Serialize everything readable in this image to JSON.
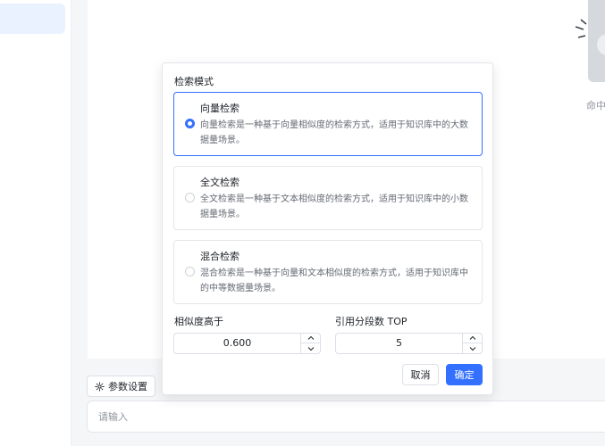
{
  "empty_state": {
    "hint_text": "命中"
  },
  "toolbar": {
    "param_settings_label": "参数设置"
  },
  "chat": {
    "input_placeholder": "请输入"
  },
  "popover": {
    "section_title": "检索模式",
    "options": [
      {
        "title": "向量检索",
        "description": "向量检索是一种基于向量相似度的检索方式，适用于知识库中的大数据量场景。",
        "selected": true
      },
      {
        "title": "全文检索",
        "description": "全文检索是一种基于文本相似度的检索方式，适用于知识库中的小数据量场景。",
        "selected": false
      },
      {
        "title": "混合检索",
        "description": "混合检索是一种基于向量和文本相似度的检索方式，适用于知识库中的中等数据量场景。",
        "selected": false
      }
    ],
    "similarity": {
      "label": "相似度高于",
      "value": "0.600"
    },
    "top_n": {
      "label": "引用分段数 TOP",
      "value": "5"
    },
    "cancel_label": "取消",
    "confirm_label": "确定"
  },
  "colors": {
    "accent": "#3370ff",
    "border": "#e4e6eb",
    "text_secondary": "#646a73"
  },
  "icons": {
    "param": "gear-icon",
    "stepper_up": "chevron-up-icon",
    "stepper_down": "chevron-down-icon"
  }
}
